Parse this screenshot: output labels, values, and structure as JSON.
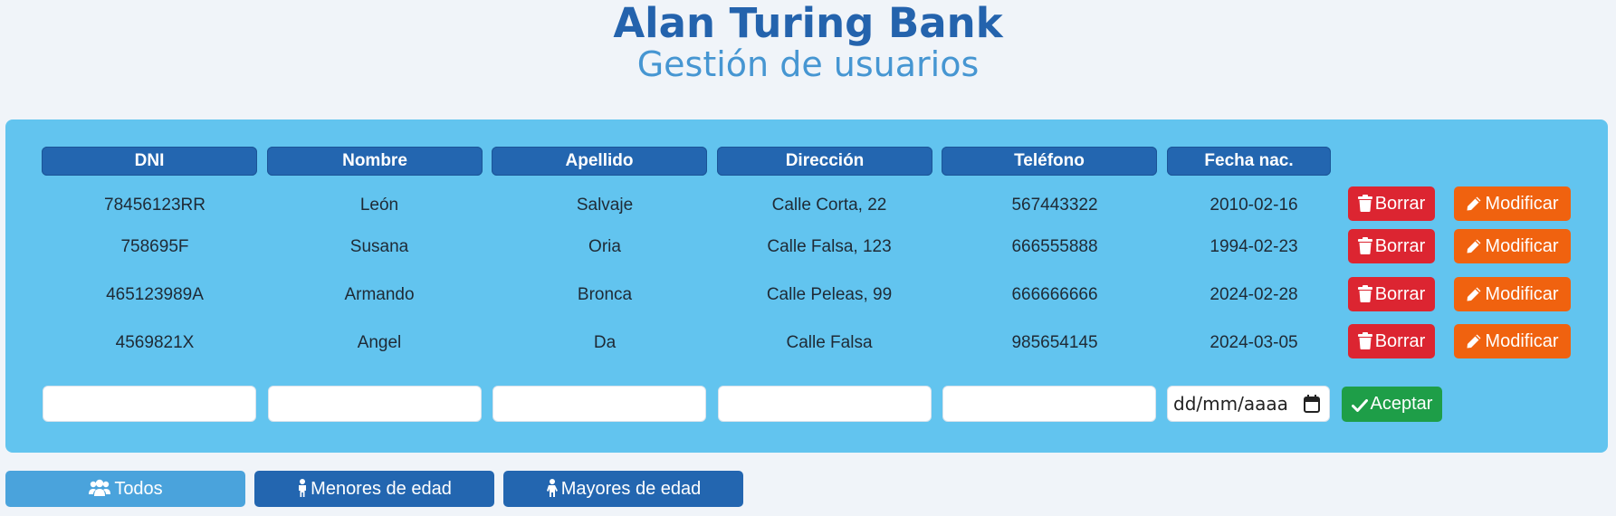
{
  "header": {
    "title": "Alan Turing Bank",
    "subtitle": "Gestión de usuarios"
  },
  "table": {
    "columns": [
      "DNI",
      "Nombre",
      "Apellido",
      "Dirección",
      "Teléfono",
      "Fecha nac."
    ],
    "rows": [
      {
        "dni": "78456123RR",
        "nombre": "León",
        "apellido": "Salvaje",
        "direccion": "Calle Corta, 22",
        "telefono": "567443322",
        "fecha": "2010-02-16"
      },
      {
        "dni": "758695F",
        "nombre": "Susana",
        "apellido": "Oria",
        "direccion": "Calle Falsa, 123",
        "telefono": "666555888",
        "fecha": "1994-02-23"
      },
      {
        "dni": "465123989A",
        "nombre": "Armando",
        "apellido": "Bronca",
        "direccion": "Calle Peleas, 99",
        "telefono": "666666666",
        "fecha": "2024-02-28"
      },
      {
        "dni": "4569821X",
        "nombre": "Angel",
        "apellido": "Da",
        "direccion": "Calle Falsa",
        "telefono": "985654145",
        "fecha": "2024-03-05"
      }
    ],
    "delete_label": "Borrar",
    "modify_label": "Modificar"
  },
  "form": {
    "date_placeholder": "dd/mm/aaaa",
    "accept_label": "Aceptar"
  },
  "filters": [
    {
      "label": "Todos",
      "icon": "users-icon",
      "active": true
    },
    {
      "label": "Menores de edad",
      "icon": "child-icon",
      "active": false
    },
    {
      "label": "Mayores de edad",
      "icon": "person-icon",
      "active": false
    }
  ],
  "colors": {
    "title": "#2463ad",
    "subtitle": "#4696d2",
    "panel": "#62c4ef",
    "header_cell": "#2366b0",
    "delete": "#dc2531",
    "modify": "#f0620f",
    "accept": "#1e9e48",
    "filter_active": "#4aa3dc",
    "filter_inactive": "#2366b0"
  }
}
